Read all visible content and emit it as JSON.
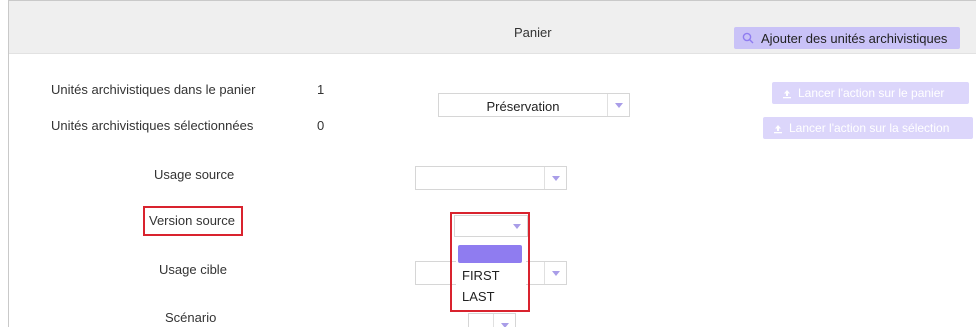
{
  "header": {
    "title": "Panier",
    "add_button_label": "Ajouter des unités archivistiques"
  },
  "stats": [
    {
      "label": "Unités archivistiques dans le panier",
      "value": "1"
    },
    {
      "label": "Unités archivistiques sélectionnées",
      "value": "0"
    }
  ],
  "action_select": {
    "value": "Préservation"
  },
  "actions": {
    "run_on_cart_label": "Lancer l'action sur le panier",
    "run_on_selection_label": "Lancer l'action sur la sélection"
  },
  "fields": {
    "usage_source": {
      "label": "Usage source",
      "value": ""
    },
    "version_source": {
      "label": "Version source",
      "value": "",
      "options": [
        "",
        "FIRST",
        "LAST"
      ]
    },
    "usage_cible": {
      "label": "Usage cible",
      "value": ""
    },
    "scenario": {
      "label": "Scénario",
      "value": ""
    }
  },
  "colors": {
    "accent": "#8f7cf0",
    "button_bg": "#c9c2f7",
    "disabled_button_bg": "#dcd6fb",
    "highlight": "#d9232e",
    "header_bg": "#efefef"
  },
  "icons": {
    "add_button": "search-icon",
    "action_buttons": "upload-icon",
    "select_caret": "chevron-down-icon"
  }
}
